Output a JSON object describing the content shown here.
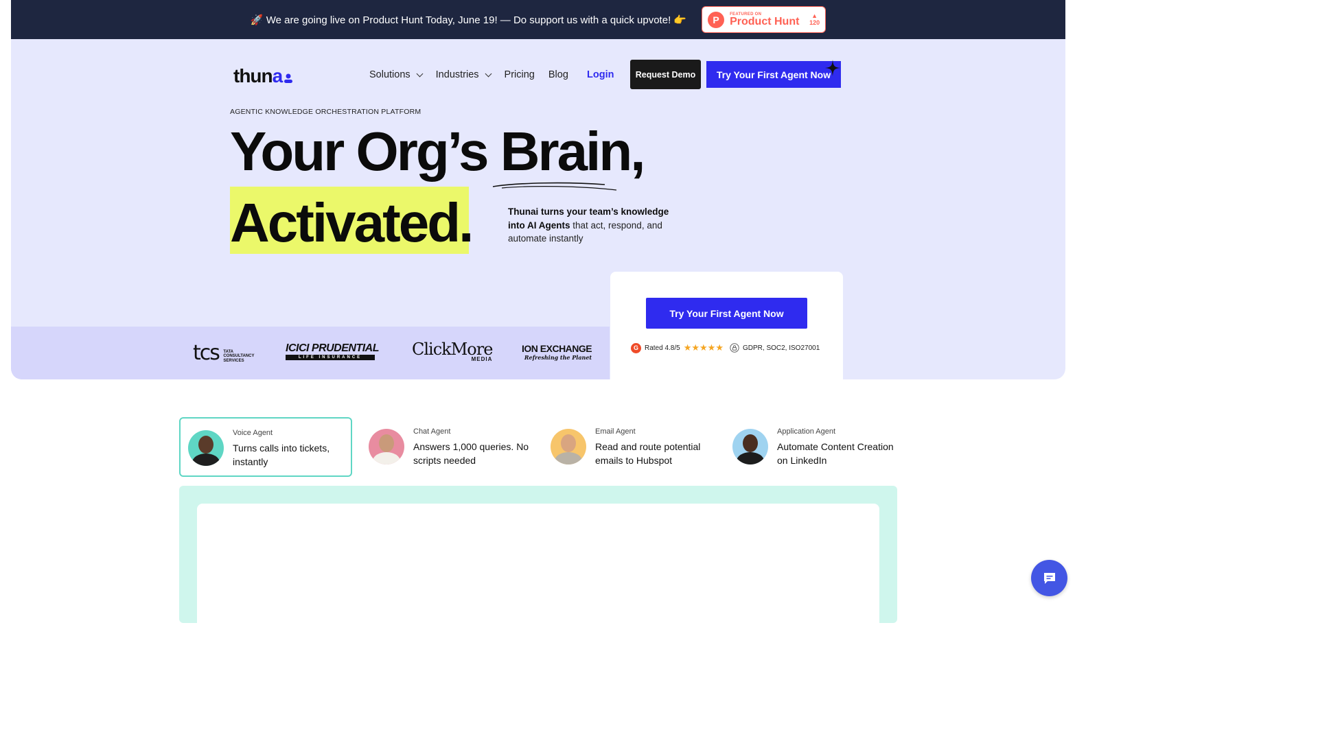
{
  "banner": {
    "text": "🚀 We are going live on Product Hunt Today, June 19! — Do support us with a quick upvote! 👉",
    "badge_small": "FEATURED ON",
    "badge_big": "Product Hunt",
    "badge_count": "120",
    "badge_arrow": "▲",
    "badge_logo": "P"
  },
  "header": {
    "logo_main": "thun",
    "logo_accent": "a",
    "logo_icon": "user-dot-icon",
    "nav": [
      {
        "label": "Solutions",
        "dropdown": true
      },
      {
        "label": "Industries",
        "dropdown": true
      },
      {
        "label": "Pricing",
        "dropdown": false
      },
      {
        "label": "Blog",
        "dropdown": false
      }
    ],
    "login": "Login",
    "request_demo": "Request Demo",
    "try_agent": "Try Your First Agent Now"
  },
  "hero": {
    "eyebrow": "AGENTIC KNOWLEDGE ORCHESTRATION PLATFORM",
    "headline_line1": "Your Org’s Brain,",
    "headline_line2": "Activated.",
    "sub_bold": "Thunai turns your team’s knowledge into AI Agents",
    "sub_rest": " that act, respond, and automate instantly",
    "highlight_color": "#ebf86a",
    "accent_color": "#2f2bef"
  },
  "clients": [
    {
      "name": "tcs",
      "sub": "TATA CONSULTANCY SERVICES"
    },
    {
      "name": "ICICI PRUDENTIAL",
      "sub": "LIFE INSURANCE"
    },
    {
      "name": "ClickMore",
      "sub": "MEDIA"
    },
    {
      "name": "ION EXCHANGE",
      "sub": "Refreshing the Planet"
    }
  ],
  "cta_card": {
    "button": "Try Your First Agent Now",
    "g2_logo": "G",
    "rating": "Rated 4.8/5",
    "stars": "★★★★★",
    "compliance": "GDPR, SOC2, ISO27001"
  },
  "agents": [
    {
      "type": "Voice Agent",
      "desc": "Turns calls into tickets, instantly",
      "active": true,
      "bg": "#5fd6c4"
    },
    {
      "type": "Chat Agent",
      "desc": "Answers 1,000 queries. No scripts needed",
      "active": false,
      "bg": "#e88ca0"
    },
    {
      "type": "Email Agent",
      "desc": "Read and route potential emails to Hubspot",
      "active": false,
      "bg": "#f7c56b"
    },
    {
      "type": "Application Agent",
      "desc": "Automate Content Creation on LinkedIn",
      "active": false,
      "bg": "#9fd3f0"
    }
  ],
  "chat_fab": {
    "icon": "chat-icon"
  }
}
